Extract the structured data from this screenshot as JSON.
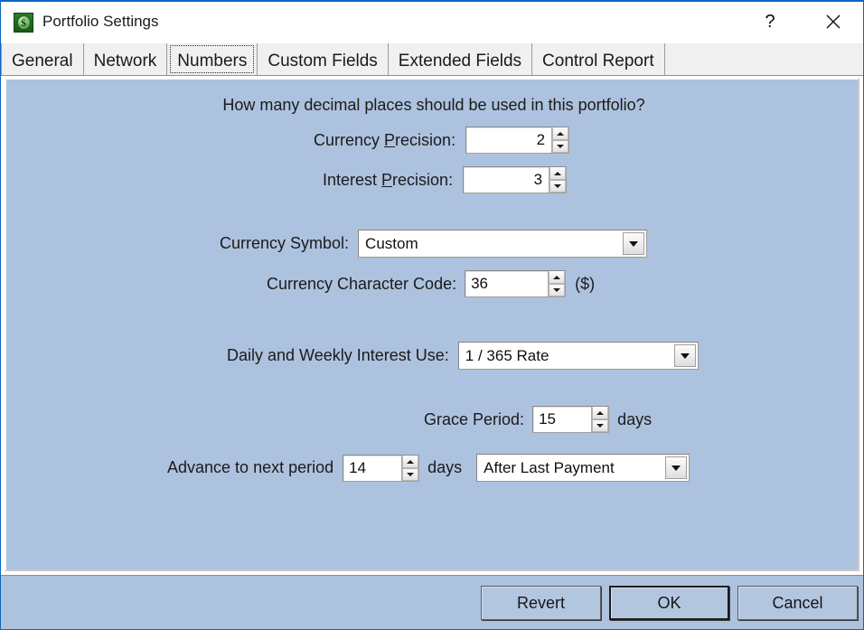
{
  "window": {
    "title": "Portfolio Settings",
    "icon": "money-bag-icon",
    "icon_glyph": "$",
    "help_button": "?",
    "close_button": "✕",
    "accent_color": "#0a68c1",
    "panel_color": "#adc2de"
  },
  "tabs": [
    {
      "label": "General",
      "active": false
    },
    {
      "label": "Network",
      "active": false
    },
    {
      "label": "Numbers",
      "active": true
    },
    {
      "label": "Custom Fields",
      "active": false
    },
    {
      "label": "Extended Fields",
      "active": false
    },
    {
      "label": "Control Report",
      "active": false
    }
  ],
  "form": {
    "heading": "How many decimal places should be used in this portfolio?",
    "currency_precision": {
      "label_pre": "Currency ",
      "label_accel": "P",
      "label_post": "recision:",
      "value": "2"
    },
    "interest_precision": {
      "label_pre": "Interest ",
      "label_accel": "P",
      "label_post": "recision:",
      "value": "3"
    },
    "currency_symbol": {
      "label": "Currency Symbol:",
      "value": "Custom",
      "options": [
        "Custom"
      ]
    },
    "currency_char_code": {
      "label": "Currency Character Code:",
      "value": "36",
      "preview": "($)"
    },
    "interest_use": {
      "label": "Daily and Weekly Interest Use:",
      "value": "1 / 365 Rate",
      "options": [
        "1 / 365 Rate"
      ]
    },
    "grace_period": {
      "label": "Grace Period:",
      "value": "15",
      "units": "days"
    },
    "advance_period": {
      "label": "Advance to next period",
      "value": "14",
      "units": "days",
      "mode": "After Last Payment",
      "options": [
        "After Last Payment"
      ]
    }
  },
  "footer": {
    "revert_label": "Revert",
    "ok_label": "OK",
    "cancel_label": "Cancel"
  }
}
